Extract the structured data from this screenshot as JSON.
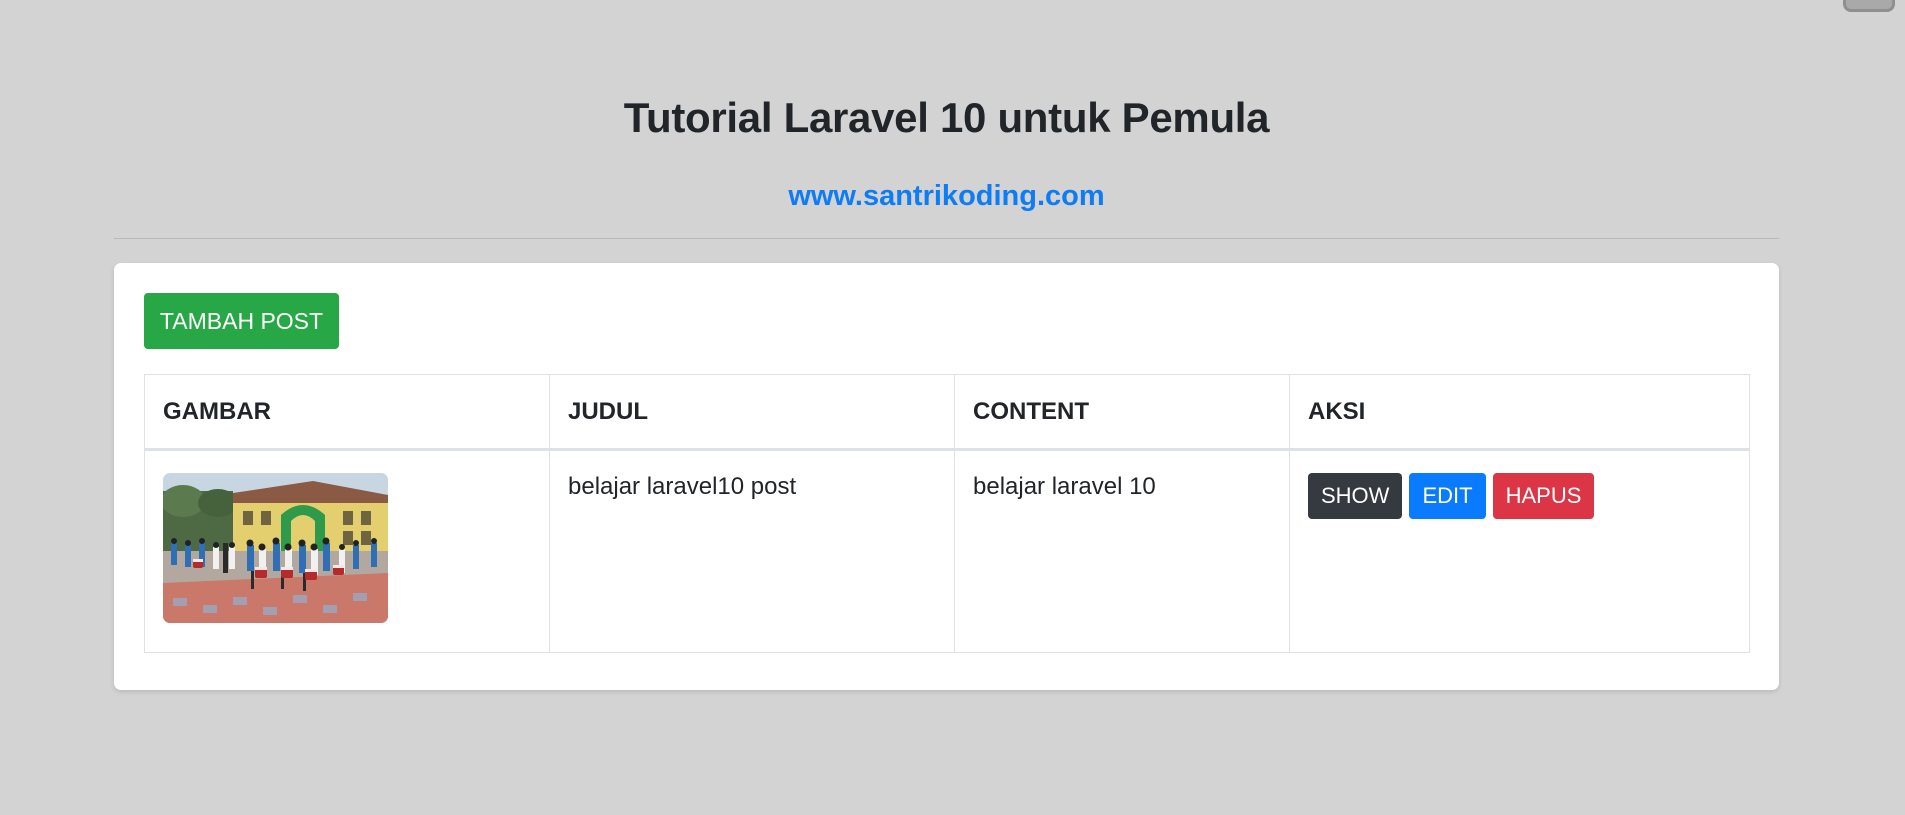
{
  "header": {
    "title": "Tutorial Laravel 10 untuk Pemula",
    "site_link": "www.santrikoding.com"
  },
  "card": {
    "add_button_label": "TAMBAH POST",
    "table": {
      "columns": [
        "GAMBAR",
        "JUDUL",
        "CONTENT",
        "AKSI"
      ],
      "rows": [
        {
          "image_desc": "marching band on school courtyard",
          "judul": "belajar laravel10 post",
          "content": "belajar laravel 10",
          "actions": {
            "show": "SHOW",
            "edit": "EDIT",
            "hapus": "HAPUS"
          }
        }
      ]
    }
  },
  "colors": {
    "background": "#d3d3d3",
    "link": "#0d7cf5",
    "add_button": "#27a745",
    "show_button": "#343a40",
    "edit_button": "#0a7bff",
    "hapus_button": "#dc3545"
  }
}
